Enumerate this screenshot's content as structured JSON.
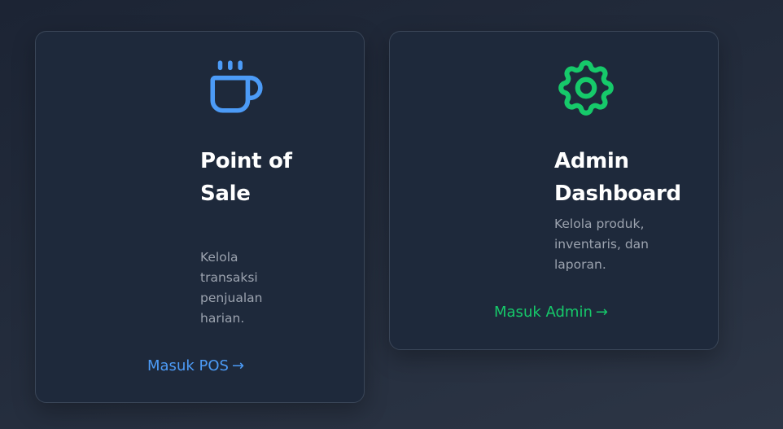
{
  "cards": [
    {
      "title": "Point of Sale",
      "description": "Kelola transaksi penjualan harian.",
      "link_label": "Masuk POS",
      "link_arrow": "→",
      "icon": "coffee-cup-icon",
      "accent": "#4c9bf7"
    },
    {
      "title": "Admin Dashboard",
      "description": "Kelola produk, inventaris, dan laporan.",
      "link_label": "Masuk Admin",
      "link_arrow": "→",
      "icon": "gear-icon",
      "accent": "#16c96a"
    }
  ]
}
